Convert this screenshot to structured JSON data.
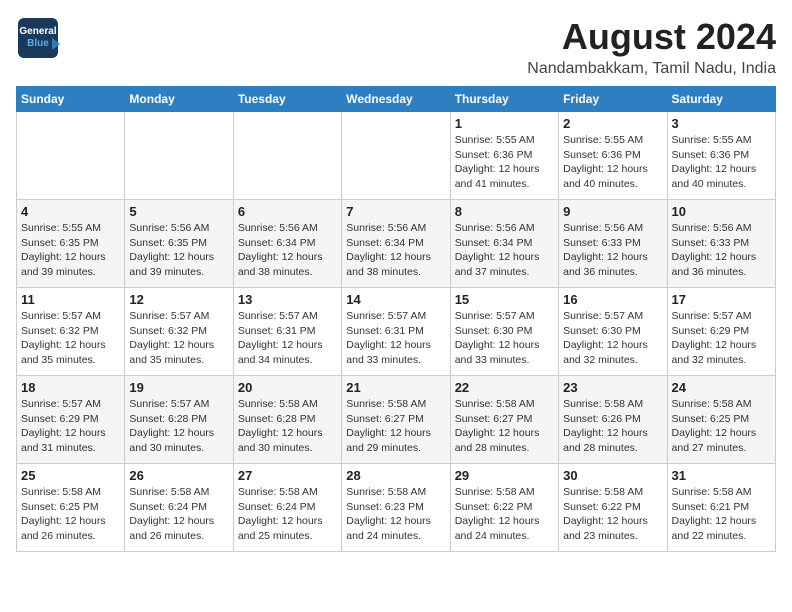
{
  "logo": {
    "line1": "General",
    "line2": "Blue"
  },
  "title": "August 2024",
  "subtitle": "Nandambakkam, Tamil Nadu, India",
  "days_of_week": [
    "Sunday",
    "Monday",
    "Tuesday",
    "Wednesday",
    "Thursday",
    "Friday",
    "Saturday"
  ],
  "weeks": [
    [
      {
        "day": "",
        "info": ""
      },
      {
        "day": "",
        "info": ""
      },
      {
        "day": "",
        "info": ""
      },
      {
        "day": "",
        "info": ""
      },
      {
        "day": "1",
        "info": "Sunrise: 5:55 AM\nSunset: 6:36 PM\nDaylight: 12 hours\nand 41 minutes."
      },
      {
        "day": "2",
        "info": "Sunrise: 5:55 AM\nSunset: 6:36 PM\nDaylight: 12 hours\nand 40 minutes."
      },
      {
        "day": "3",
        "info": "Sunrise: 5:55 AM\nSunset: 6:36 PM\nDaylight: 12 hours\nand 40 minutes."
      }
    ],
    [
      {
        "day": "4",
        "info": "Sunrise: 5:55 AM\nSunset: 6:35 PM\nDaylight: 12 hours\nand 39 minutes."
      },
      {
        "day": "5",
        "info": "Sunrise: 5:56 AM\nSunset: 6:35 PM\nDaylight: 12 hours\nand 39 minutes."
      },
      {
        "day": "6",
        "info": "Sunrise: 5:56 AM\nSunset: 6:34 PM\nDaylight: 12 hours\nand 38 minutes."
      },
      {
        "day": "7",
        "info": "Sunrise: 5:56 AM\nSunset: 6:34 PM\nDaylight: 12 hours\nand 38 minutes."
      },
      {
        "day": "8",
        "info": "Sunrise: 5:56 AM\nSunset: 6:34 PM\nDaylight: 12 hours\nand 37 minutes."
      },
      {
        "day": "9",
        "info": "Sunrise: 5:56 AM\nSunset: 6:33 PM\nDaylight: 12 hours\nand 36 minutes."
      },
      {
        "day": "10",
        "info": "Sunrise: 5:56 AM\nSunset: 6:33 PM\nDaylight: 12 hours\nand 36 minutes."
      }
    ],
    [
      {
        "day": "11",
        "info": "Sunrise: 5:57 AM\nSunset: 6:32 PM\nDaylight: 12 hours\nand 35 minutes."
      },
      {
        "day": "12",
        "info": "Sunrise: 5:57 AM\nSunset: 6:32 PM\nDaylight: 12 hours\nand 35 minutes."
      },
      {
        "day": "13",
        "info": "Sunrise: 5:57 AM\nSunset: 6:31 PM\nDaylight: 12 hours\nand 34 minutes."
      },
      {
        "day": "14",
        "info": "Sunrise: 5:57 AM\nSunset: 6:31 PM\nDaylight: 12 hours\nand 33 minutes."
      },
      {
        "day": "15",
        "info": "Sunrise: 5:57 AM\nSunset: 6:30 PM\nDaylight: 12 hours\nand 33 minutes."
      },
      {
        "day": "16",
        "info": "Sunrise: 5:57 AM\nSunset: 6:30 PM\nDaylight: 12 hours\nand 32 minutes."
      },
      {
        "day": "17",
        "info": "Sunrise: 5:57 AM\nSunset: 6:29 PM\nDaylight: 12 hours\nand 32 minutes."
      }
    ],
    [
      {
        "day": "18",
        "info": "Sunrise: 5:57 AM\nSunset: 6:29 PM\nDaylight: 12 hours\nand 31 minutes."
      },
      {
        "day": "19",
        "info": "Sunrise: 5:57 AM\nSunset: 6:28 PM\nDaylight: 12 hours\nand 30 minutes."
      },
      {
        "day": "20",
        "info": "Sunrise: 5:58 AM\nSunset: 6:28 PM\nDaylight: 12 hours\nand 30 minutes."
      },
      {
        "day": "21",
        "info": "Sunrise: 5:58 AM\nSunset: 6:27 PM\nDaylight: 12 hours\nand 29 minutes."
      },
      {
        "day": "22",
        "info": "Sunrise: 5:58 AM\nSunset: 6:27 PM\nDaylight: 12 hours\nand 28 minutes."
      },
      {
        "day": "23",
        "info": "Sunrise: 5:58 AM\nSunset: 6:26 PM\nDaylight: 12 hours\nand 28 minutes."
      },
      {
        "day": "24",
        "info": "Sunrise: 5:58 AM\nSunset: 6:25 PM\nDaylight: 12 hours\nand 27 minutes."
      }
    ],
    [
      {
        "day": "25",
        "info": "Sunrise: 5:58 AM\nSunset: 6:25 PM\nDaylight: 12 hours\nand 26 minutes."
      },
      {
        "day": "26",
        "info": "Sunrise: 5:58 AM\nSunset: 6:24 PM\nDaylight: 12 hours\nand 26 minutes."
      },
      {
        "day": "27",
        "info": "Sunrise: 5:58 AM\nSunset: 6:24 PM\nDaylight: 12 hours\nand 25 minutes."
      },
      {
        "day": "28",
        "info": "Sunrise: 5:58 AM\nSunset: 6:23 PM\nDaylight: 12 hours\nand 24 minutes."
      },
      {
        "day": "29",
        "info": "Sunrise: 5:58 AM\nSunset: 6:22 PM\nDaylight: 12 hours\nand 24 minutes."
      },
      {
        "day": "30",
        "info": "Sunrise: 5:58 AM\nSunset: 6:22 PM\nDaylight: 12 hours\nand 23 minutes."
      },
      {
        "day": "31",
        "info": "Sunrise: 5:58 AM\nSunset: 6:21 PM\nDaylight: 12 hours\nand 22 minutes."
      }
    ]
  ]
}
